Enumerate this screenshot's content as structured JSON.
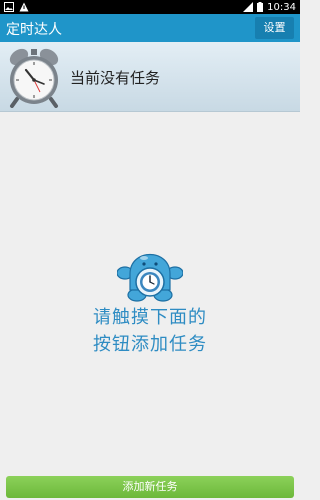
{
  "status_bar": {
    "time": "10:34"
  },
  "app_bar": {
    "title": "定时达人",
    "settings_label": "设置"
  },
  "status_panel": {
    "message": "当前没有任务"
  },
  "empty_state": {
    "line1": "请触摸下面的",
    "line2": "按钮添加任务"
  },
  "footer": {
    "add_task_label": "添加新任务"
  },
  "colors": {
    "accent": "#1f95c9",
    "hint_text": "#2e8cc3",
    "add_button": "#76c043"
  }
}
